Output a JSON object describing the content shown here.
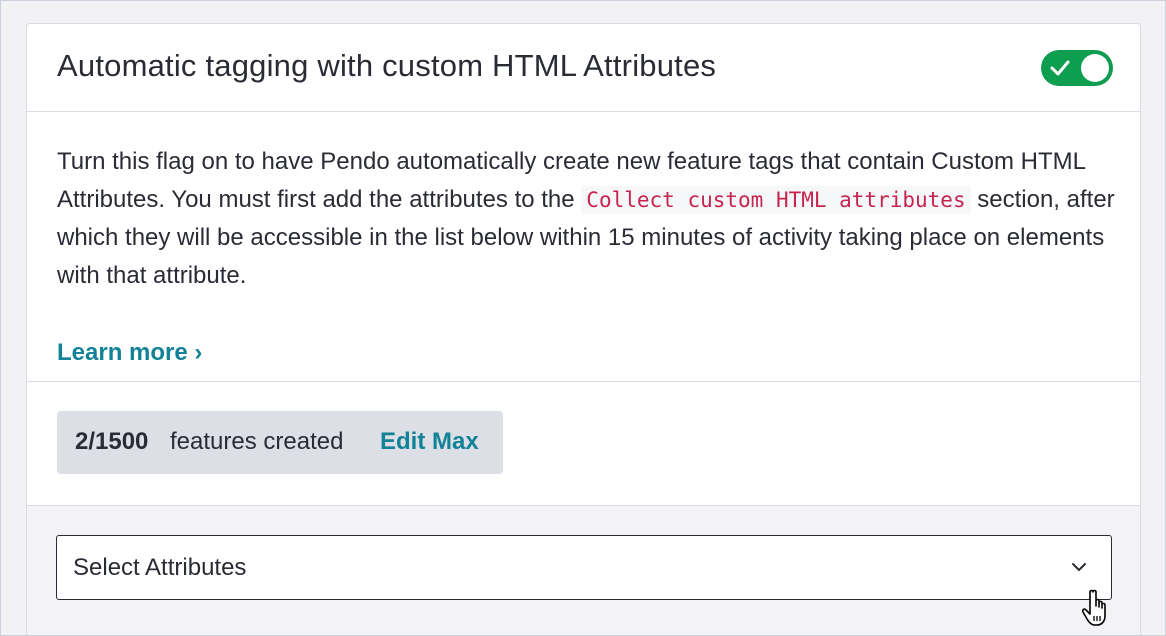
{
  "header": {
    "title": "Automatic tagging with custom HTML Attributes",
    "toggle_state": "on",
    "toggle_color": "#0d9e4f",
    "toggle_icon": "check-icon"
  },
  "description": {
    "text_before_code": "Turn this flag on to have Pendo automatically create new feature tags that contain Custom HTML Attributes. You must first add the attributes to the ",
    "code": "Collect custom HTML attributes",
    "text_after_code": " section, after which they will be accessible in the list below within 15 minutes of activity taking place on elements with that attribute.",
    "learn_more_label": "Learn more ›",
    "link_color": "#128297"
  },
  "features": {
    "count": "2/1500",
    "label": "features created",
    "edit_label": "Edit Max"
  },
  "attributes_select": {
    "placeholder": "Select Attributes",
    "icon": "chevron-down-icon"
  },
  "cursor": {
    "icon": "hand-pointer-cursor-icon"
  }
}
